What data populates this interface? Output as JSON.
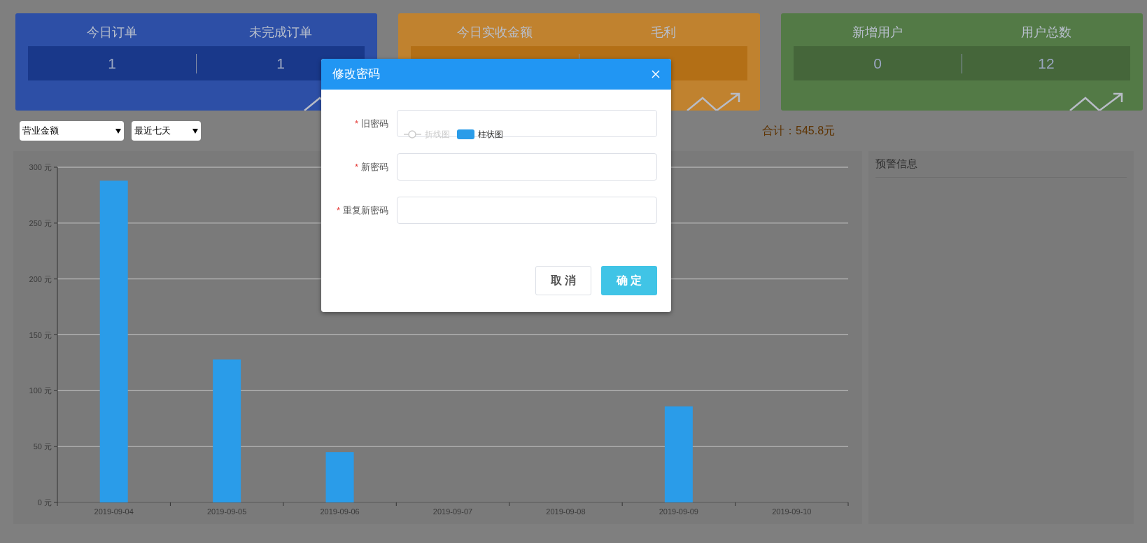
{
  "cards": [
    {
      "kind": "blue",
      "stats": [
        {
          "label": "今日订单",
          "value": "1"
        },
        {
          "label": "未完成订单",
          "value": "1"
        }
      ]
    },
    {
      "kind": "orange",
      "stats": [
        {
          "label": "今日实收金额"
        },
        {
          "label": "毛利"
        }
      ]
    },
    {
      "kind": "green",
      "stats": [
        {
          "label": "新增用户",
          "value": "0"
        },
        {
          "label": "用户总数",
          "value": "12"
        }
      ]
    }
  ],
  "filters": [
    {
      "value": "营业金额"
    },
    {
      "value": "最近七天"
    }
  ],
  "total": "合计：545.8元",
  "chart": {
    "legend": [
      {
        "kind": "line",
        "label": "折线图",
        "selected": false
      },
      {
        "kind": "bar",
        "label": "柱状图",
        "selected": true
      }
    ],
    "chart_data": {
      "type": "bar",
      "categories": [
        "2019-09-04",
        "2019-09-05",
        "2019-09-06",
        "2019-09-07",
        "2019-09-08",
        "2019-09-09",
        "2019-09-10"
      ],
      "series": [
        {
          "color": "#2a9ce9",
          "values": [
            288,
            128,
            45,
            0,
            0,
            86,
            0
          ]
        }
      ],
      "grid": true,
      "ylim": [
        0,
        300
      ],
      "yticks": [
        {
          "value": 0,
          "label": "0 元"
        },
        {
          "value": 50,
          "label": "50 元"
        },
        {
          "value": 100,
          "label": "100 元"
        },
        {
          "value": 150,
          "label": "150 元"
        },
        {
          "value": 200,
          "label": "200 元"
        },
        {
          "value": 250,
          "label": "250 元"
        },
        {
          "value": 300,
          "label": "300 元"
        }
      ]
    }
  },
  "alerts": {
    "title": "预警信息"
  },
  "dialog": {
    "title": "修改密码",
    "required_mark": "*",
    "fields": [
      {
        "label": "旧密码",
        "required": true
      },
      {
        "label": "新密码",
        "required": true
      },
      {
        "label": "重复新密码",
        "required": true
      }
    ],
    "buttons": [
      {
        "kind": "secondary",
        "label": "取 消"
      },
      {
        "kind": "primary",
        "label": "确 定"
      }
    ]
  }
}
